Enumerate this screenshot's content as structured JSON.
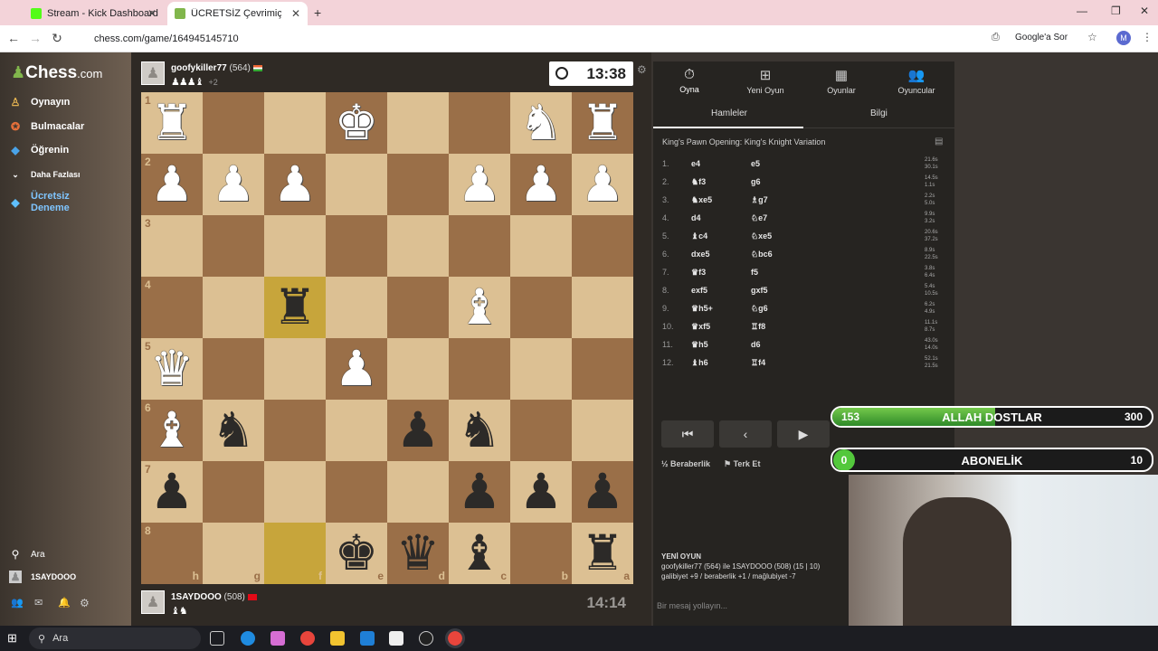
{
  "browser": {
    "tabs": [
      {
        "title": "Stream - Kick Dashboard"
      },
      {
        "title": "ÜCRETSİZ Çevrimiçi Satranç"
      }
    ],
    "url": "chess.com/game/164945145710",
    "google_label": "Google'a Sor",
    "profile_initial": "M"
  },
  "sidebar": {
    "logo": "Chess",
    "logo_suffix": ".com",
    "items": [
      {
        "label": "Oynayın",
        "icon": "play-icon"
      },
      {
        "label": "Bulmacalar",
        "icon": "puzzle-icon"
      },
      {
        "label": "Öğrenin",
        "icon": "learn-icon"
      },
      {
        "label": "Daha Fazlası",
        "icon": "chevron-down-icon"
      },
      {
        "label": "Ücretsiz Deneme",
        "icon": "diamond-icon"
      }
    ],
    "search_label": "Ara",
    "username": "1SAYDOOO"
  },
  "game": {
    "top_player": {
      "name": "goofykiller77",
      "rating": "(564)",
      "captured": "♟♟♟♝",
      "extra": "+2"
    },
    "bottom_player": {
      "name": "1SAYDOOO",
      "rating": "(508)",
      "captured": "♝♞"
    },
    "top_clock": "13:38",
    "bottom_clock": "14:14",
    "ranks": [
      "1",
      "2",
      "3",
      "4",
      "5",
      "6",
      "7",
      "8"
    ],
    "files": [
      "h",
      "g",
      "f",
      "e",
      "d",
      "c",
      "b",
      "a"
    ]
  },
  "panel": {
    "tabs": [
      {
        "label": "Oyna",
        "icon": "clock-icon"
      },
      {
        "label": "Yeni Oyun",
        "icon": "plus-icon"
      },
      {
        "label": "Oyunlar",
        "icon": "board-icon"
      },
      {
        "label": "Oyuncular",
        "icon": "players-icon"
      }
    ],
    "subtabs": [
      "Hamleler",
      "Bilgi"
    ],
    "opening": "King's Pawn Opening: King's Knight Variation",
    "moves": [
      {
        "n": "1.",
        "w": "e4",
        "b": "e5",
        "tw": "21.6s",
        "tb": "30.1s"
      },
      {
        "n": "2.",
        "w": "♞f3",
        "b": "g6",
        "tw": "14.5s",
        "tb": "1.1s"
      },
      {
        "n": "3.",
        "w": "♞xe5",
        "b": "♗g7",
        "tw": "2.2s",
        "tb": "5.0s"
      },
      {
        "n": "4.",
        "w": "d4",
        "b": "♘e7",
        "tw": "9.9s",
        "tb": "3.2s"
      },
      {
        "n": "5.",
        "w": "♝c4",
        "b": "♘xe5",
        "tw": "20.6s",
        "tb": "37.2s"
      },
      {
        "n": "6.",
        "w": "dxe5",
        "b": "♘bc6",
        "tw": "8.9s",
        "tb": "22.5s"
      },
      {
        "n": "7.",
        "w": "♛f3",
        "b": "f5",
        "tw": "3.8s",
        "tb": "6.4s"
      },
      {
        "n": "8.",
        "w": "exf5",
        "b": "gxf5",
        "tw": "5.4s",
        "tb": "10.5s"
      },
      {
        "n": "9.",
        "w": "♛h5+",
        "b": "♘g6",
        "tw": "6.2s",
        "tb": "4.9s"
      },
      {
        "n": "10.",
        "w": "♛xf5",
        "b": "♖f8",
        "tw": "11.1s",
        "tb": "8.7s"
      },
      {
        "n": "11.",
        "w": "♛h5",
        "b": "d6",
        "tw": "43.0s",
        "tb": "14.0s"
      },
      {
        "n": "12.",
        "w": "♝h6",
        "b": "♖f4",
        "tw": "52.1s",
        "tb": "21.5s"
      }
    ],
    "draw_label": "Beraberlik",
    "resign_label": "Terk Et",
    "new_game_title": "YENİ OYUN",
    "new_game_line1": "goofykiller77 (564) ile 1SAYDOOO (508) (15 | 10)",
    "new_game_line2": "galibiyet +9 / beraberlik +1 / mağlubiyet -7",
    "chat_placeholder": "Bir mesaj yollayın..."
  },
  "overlays": {
    "goal1": {
      "current": "153",
      "label": "ALLAH DOSTLAR",
      "goal": "300",
      "progress": 0.51
    },
    "goal2": {
      "current": "0",
      "label": "ABONELİK",
      "goal": "10",
      "progress": 0.0
    }
  },
  "taskbar": {
    "search_label": "Ara"
  }
}
